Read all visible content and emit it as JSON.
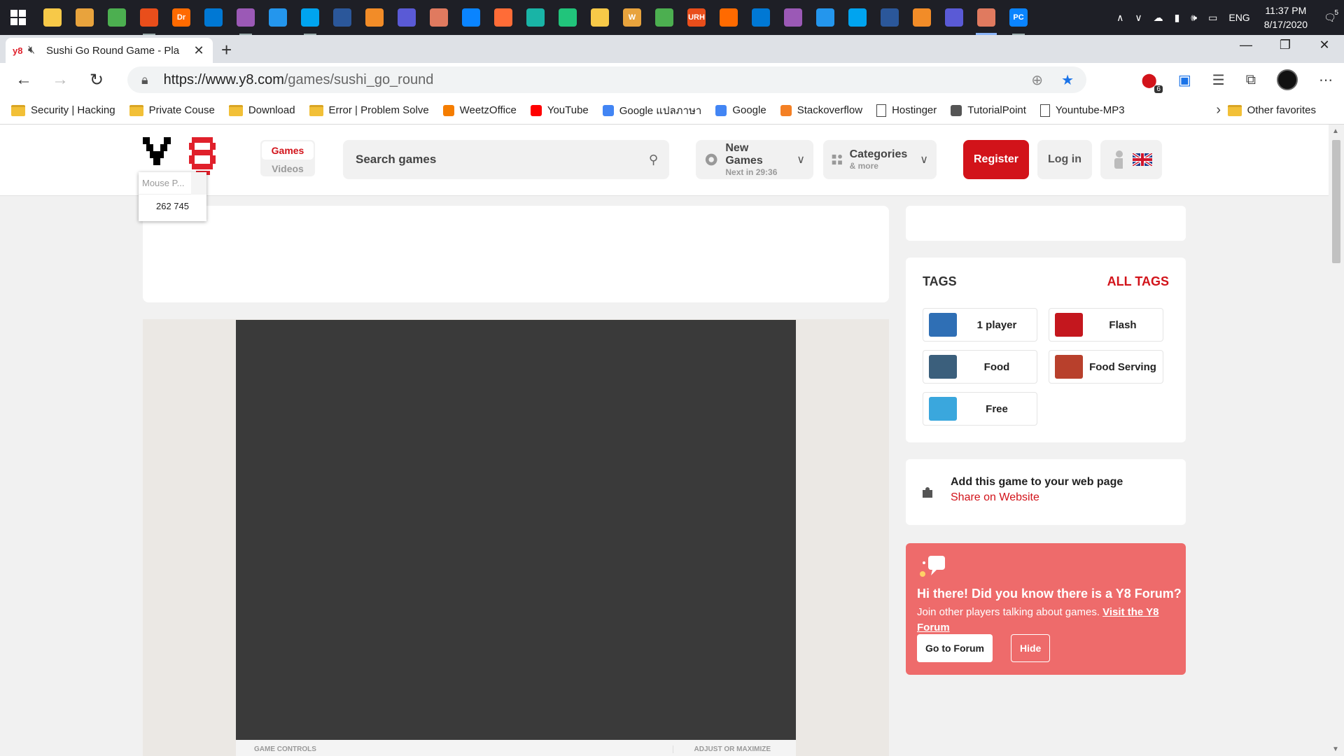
{
  "taskbar": {
    "apps": [
      {
        "icon": "search-icon",
        "state": ""
      },
      {
        "icon": "cortana-icon",
        "state": ""
      },
      {
        "icon": "task-view-icon",
        "state": ""
      },
      {
        "icon": "file-explorer-icon",
        "state": "open"
      },
      {
        "icon": "dreamweaver-icon",
        "state": "",
        "text": "Dr"
      },
      {
        "icon": "bug-icon",
        "state": ""
      },
      {
        "icon": "app-icon",
        "state": "open"
      },
      {
        "icon": "chrome-icon",
        "state": ""
      },
      {
        "icon": "app-icon",
        "state": "open"
      },
      {
        "icon": "ubuntu-icon",
        "state": ""
      },
      {
        "icon": "app-icon",
        "state": ""
      },
      {
        "icon": "virtualbox-icon",
        "state": ""
      },
      {
        "icon": "docker-icon",
        "state": ""
      },
      {
        "icon": "app-icon",
        "state": ""
      },
      {
        "icon": "app-icon",
        "state": ""
      },
      {
        "icon": "app-icon",
        "state": ""
      },
      {
        "icon": "vscode-icon",
        "state": ""
      },
      {
        "icon": "visual-studio-icon",
        "state": ""
      },
      {
        "icon": "word-icon",
        "state": "",
        "text": "W"
      },
      {
        "icon": "sublime-icon",
        "state": ""
      },
      {
        "icon": "app-icon",
        "state": "",
        "text": "URH"
      },
      {
        "icon": "app-icon",
        "state": ""
      },
      {
        "icon": "powershell-icon",
        "state": ""
      },
      {
        "icon": "terminal-icon",
        "state": ""
      },
      {
        "icon": "maps-icon",
        "state": ""
      },
      {
        "icon": "app-icon",
        "state": ""
      },
      {
        "icon": "player-icon",
        "state": ""
      },
      {
        "icon": "postman-icon",
        "state": ""
      },
      {
        "icon": "app-icon",
        "state": ""
      },
      {
        "icon": "edge-icon",
        "state": "active"
      },
      {
        "icon": "pycharm-icon",
        "state": "open",
        "text": "PC"
      }
    ],
    "tray": {
      "language": "ENG",
      "time": "11:37 PM",
      "date": "8/17/2020",
      "notifications": "5"
    }
  },
  "browser": {
    "tab": {
      "favicon": "y8",
      "title": "Sushi Go Round Game - Pla"
    },
    "url": {
      "host": "https://www.y8.com",
      "path": "/games/sushi_go_round"
    },
    "extension_badge": "6",
    "bookmarks": [
      {
        "label": "Security | Hacking",
        "icon": "folder-icon"
      },
      {
        "label": "Private Couse",
        "icon": "folder-icon"
      },
      {
        "label": "Download",
        "icon": "folder-icon"
      },
      {
        "label": "Error | Problem Solve",
        "icon": "folder-icon"
      },
      {
        "label": "WeetzOffice",
        "icon": "blogger-icon"
      },
      {
        "label": "YouTube",
        "icon": "youtube-icon"
      },
      {
        "label": "Google แปลภาษา",
        "icon": "google-translate-icon"
      },
      {
        "label": "Google",
        "icon": "google-icon"
      },
      {
        "label": "Stackoverflow",
        "icon": "stackoverflow-icon"
      },
      {
        "label": "Hostinger",
        "icon": "page-icon"
      },
      {
        "label": "TutorialPoint",
        "icon": "tutorialpoint-icon"
      },
      {
        "label": "Yountube-MP3",
        "icon": "page-icon"
      }
    ],
    "other_favorites": "Other favorites"
  },
  "site": {
    "nav_games": "Games",
    "nav_videos": "Videos",
    "search_placeholder": "Search games",
    "new_games": {
      "title": "New Games",
      "sub": "Next in 29:36"
    },
    "categories": {
      "title": "Categories",
      "sub": "& more"
    },
    "register": "Register",
    "login": "Log in",
    "mouse_popup": {
      "title": "Mouse P...",
      "value": "262 745"
    },
    "game_controls": "GAME CONTROLS",
    "adjust": "ADJUST OR MAXIMIZE",
    "tags": {
      "heading": "TAGS",
      "all": "ALL TAGS",
      "items": [
        {
          "label": "1 player",
          "color": "#2f6fb5"
        },
        {
          "label": "Flash",
          "color": "#c4171e"
        },
        {
          "label": "Food",
          "color": "#3b5f7c"
        },
        {
          "label": "Food Serving",
          "color": "#b8402c"
        },
        {
          "label": "Free",
          "color": "#3aa7dd"
        }
      ]
    },
    "share": {
      "title": "Add this game to your web page",
      "link": "Share on Website"
    },
    "forum": {
      "heading": "Hi there! Did you know there is a Y8 Forum?",
      "text": "Join other players talking about games.",
      "link": "Visit the Y8 Forum",
      "go": "Go to Forum",
      "hide": "Hide"
    }
  }
}
